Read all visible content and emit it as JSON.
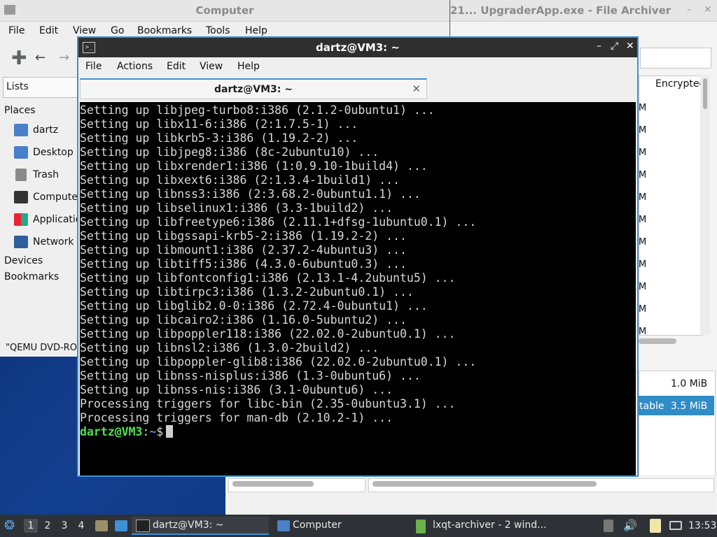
{
  "file_manager": {
    "title": "Computer",
    "menu": [
      "File",
      "Edit",
      "View",
      "Go",
      "Bookmarks",
      "Tools",
      "Help"
    ],
    "lists_label": "Lists",
    "places_label": "Places",
    "places": [
      "dartz",
      "Desktop",
      "Trash",
      "Compute",
      "Applicatio",
      "Network"
    ],
    "devices_label": "Devices",
    "bookmarks_label": "Bookmarks",
    "status_text": "\"QEMU DVD-RO"
  },
  "archiver": {
    "title": "21...  UpgraderApp.exe - File Archiver",
    "column_header": "Encrypted",
    "rows": [
      {
        "name": "",
        "size": "1.0 MiB"
      },
      {
        "name": "table",
        "size": "3.5 MiB"
      }
    ]
  },
  "terminal": {
    "window_title": "dartz@VM3: ~",
    "tab_title": "dartz@VM3: ~",
    "menu": [
      "File",
      "Actions",
      "Edit",
      "View",
      "Help"
    ],
    "lines": [
      "Setting up libjpeg-turbo8:i386 (2.1.2-0ubuntu1) ...",
      "Setting up libx11-6:i386 (2:1.7.5-1) ...",
      "Setting up libkrb5-3:i386 (1.19.2-2) ...",
      "Setting up libjpeg8:i386 (8c-2ubuntu10) ...",
      "Setting up libxrender1:i386 (1:0.9.10-1build4) ...",
      "Setting up libxext6:i386 (2:1.3.4-1build1) ...",
      "Setting up libnss3:i386 (2:3.68.2-0ubuntu1.1) ...",
      "Setting up libselinux1:i386 (3.3-1build2) ...",
      "Setting up libfreetype6:i386 (2.11.1+dfsg-1ubuntu0.1) ...",
      "Setting up libgssapi-krb5-2:i386 (1.19.2-2) ...",
      "Setting up libmount1:i386 (2.37.2-4ubuntu3) ...",
      "Setting up libtiff5:i386 (4.3.0-6ubuntu0.3) ...",
      "Setting up libfontconfig1:i386 (2.13.1-4.2ubuntu5) ...",
      "Setting up libtirpc3:i386 (1.3.2-2ubuntu0.1) ...",
      "Setting up libglib2.0-0:i386 (2.72.4-0ubuntu1) ...",
      "Setting up libcairo2:i386 (1.16.0-5ubuntu2) ...",
      "Setting up libpoppler118:i386 (22.02.0-2ubuntu0.1) ...",
      "Setting up libnsl2:i386 (1.3.0-2build2) ...",
      "Setting up libpoppler-glib8:i386 (22.02.0-2ubuntu0.1) ...",
      "Setting up libnss-nisplus:i386 (1.3-0ubuntu6) ...",
      "Setting up libnss-nis:i386 (3.1-0ubuntu6) ...",
      "Processing triggers for libc-bin (2.35-0ubuntu3.1) ...",
      "Processing triggers for man-db (2.10.2-1) ..."
    ],
    "prompt_user": "dartz@VM3",
    "prompt_sep": ":",
    "prompt_path": "~",
    "prompt_symbol": "$"
  },
  "taskbar": {
    "workspaces": [
      "1",
      "2",
      "3",
      "4"
    ],
    "tasks": [
      "dartz@VM3: ~",
      "Computer",
      "lxqt-archiver - 2 wind..."
    ],
    "clock": "13:53"
  },
  "colors": {
    "accent": "#3d8fd6",
    "prompt_green": "#4ee24e",
    "prompt_blue": "#5a8cf0",
    "selection": "#308cc6"
  }
}
